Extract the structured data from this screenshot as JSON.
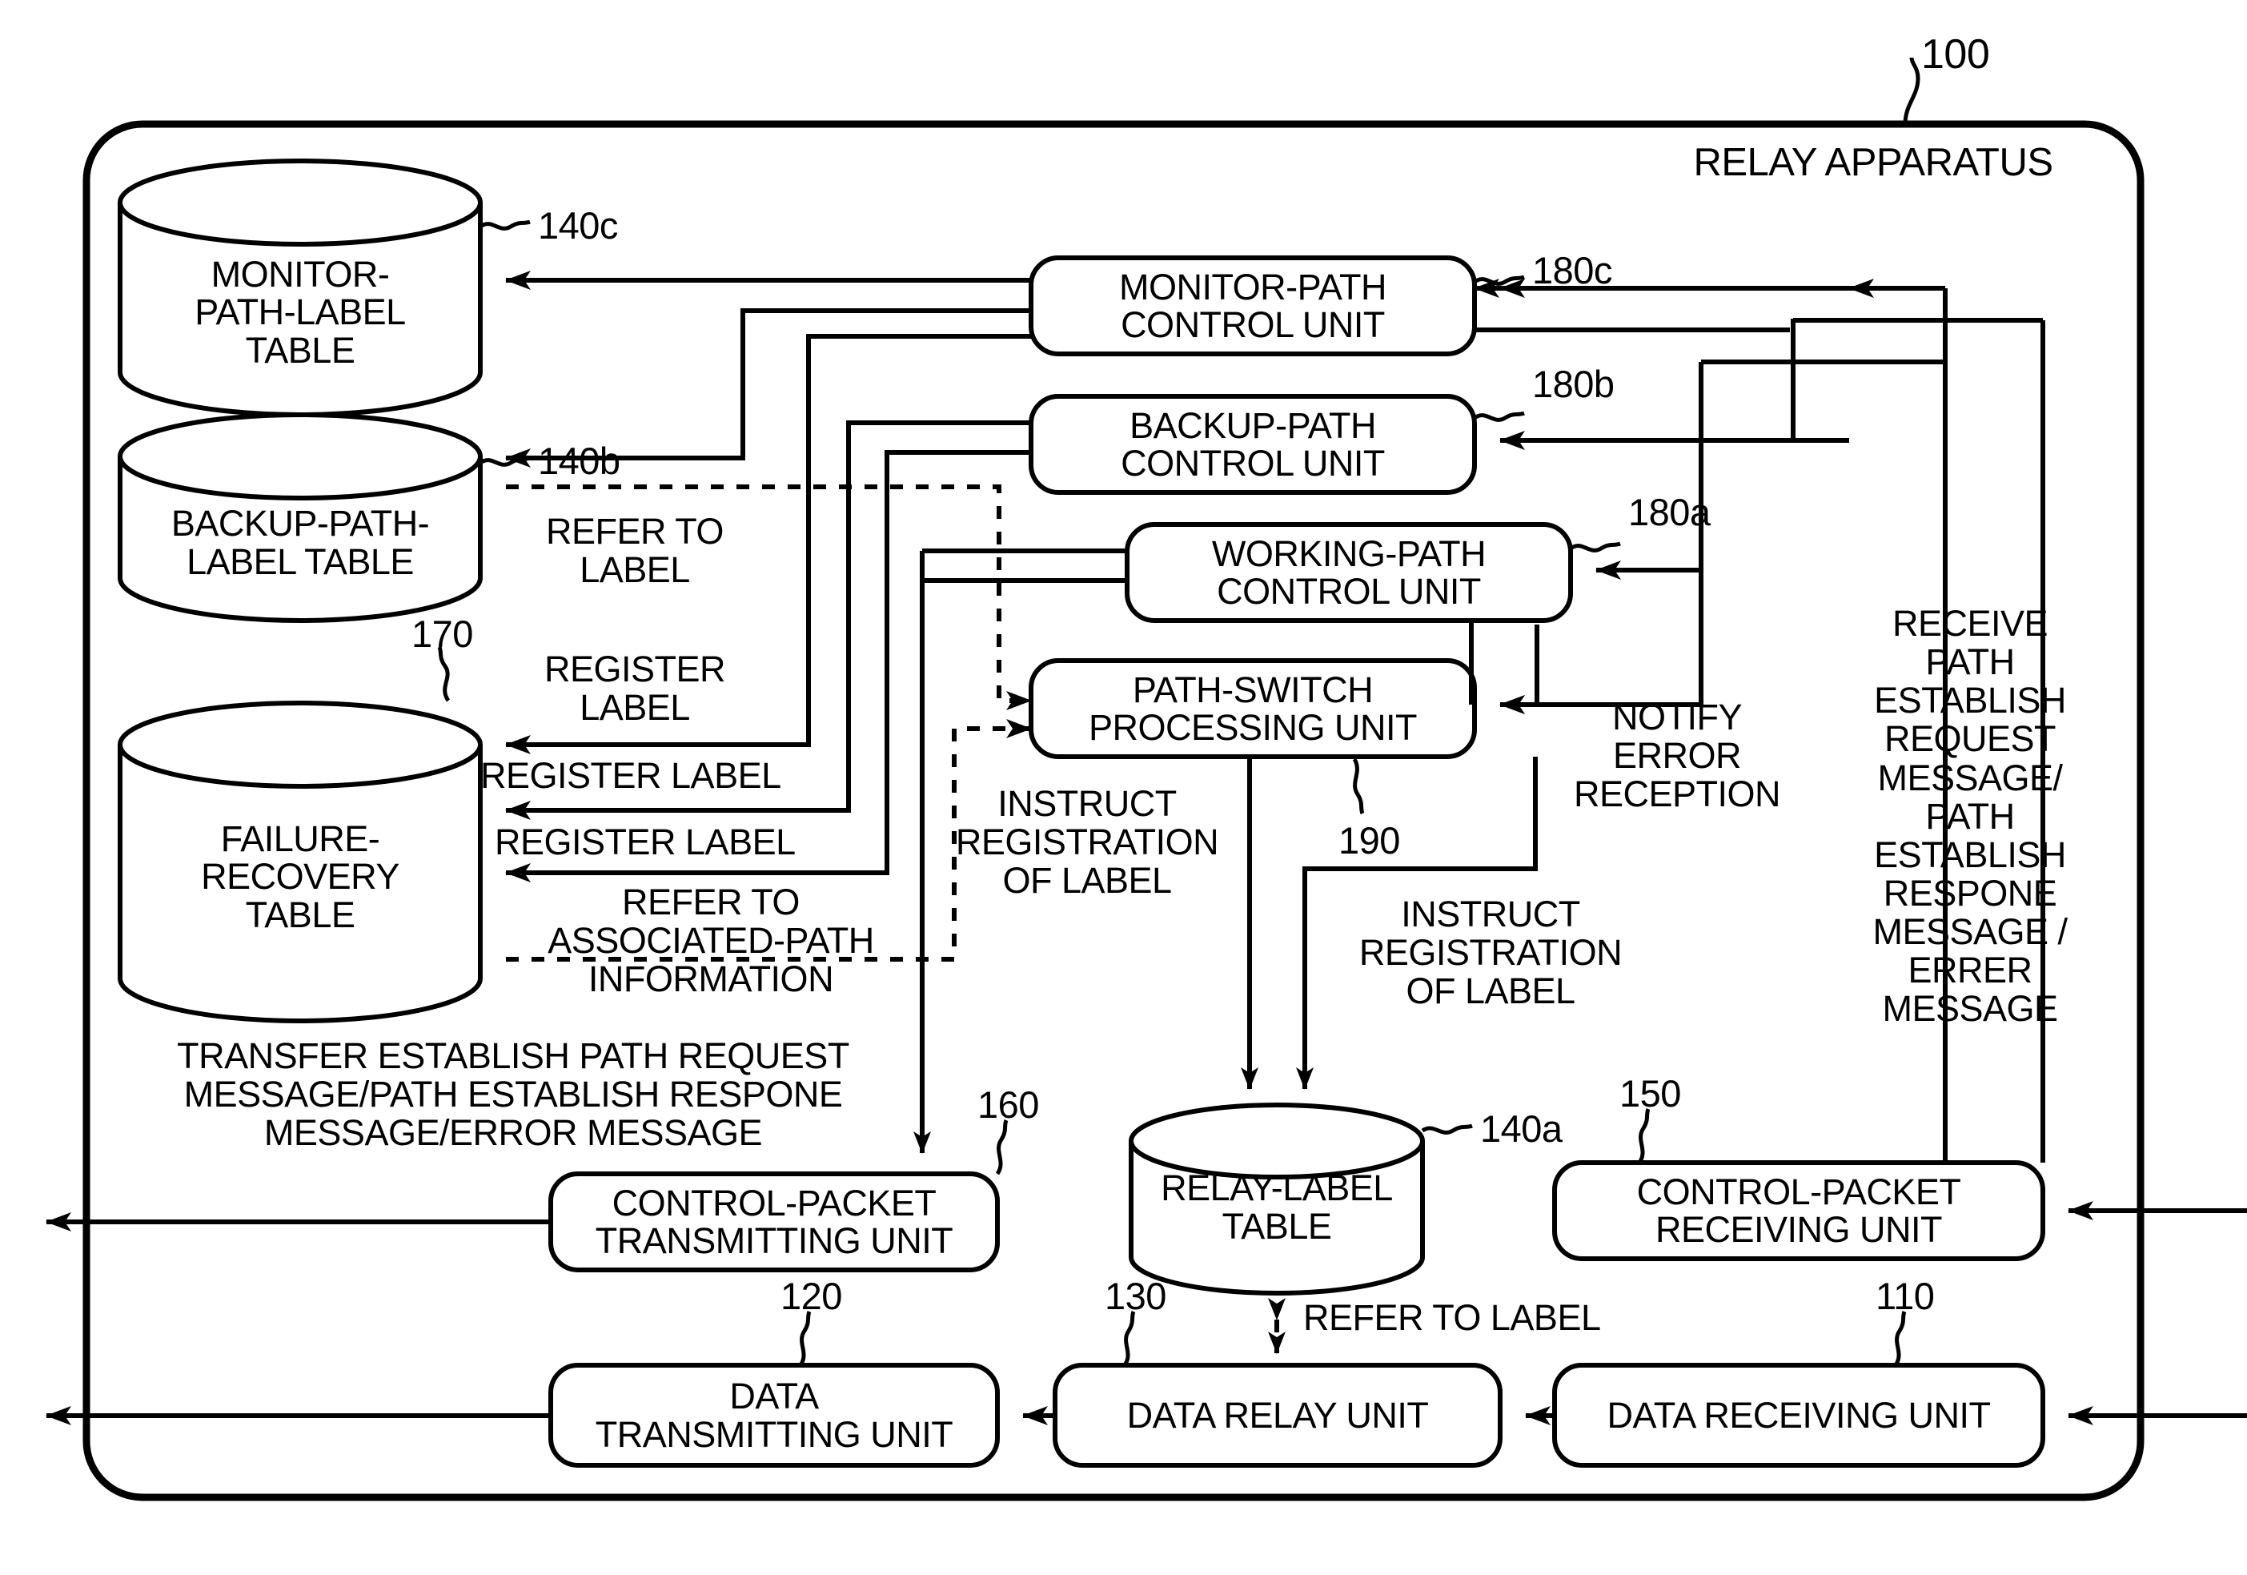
{
  "figure": {
    "title": "RELAY APPARATUS",
    "apparatus_ref": "100"
  },
  "tables": [
    {
      "id": "monitor-path-label-table",
      "label": "MONITOR-\nPATH-LABEL\nTABLE",
      "ref": "140c"
    },
    {
      "id": "backup-path-label-table",
      "label": "BACKUP-PATH-\nLABEL TABLE",
      "ref": "140b"
    },
    {
      "id": "failure-recovery-table",
      "label": "FAILURE-\nRECOVERY\nTABLE",
      "ref": "170"
    },
    {
      "id": "relay-label-table",
      "label": "RELAY-LABEL\nTABLE",
      "ref": "140a"
    }
  ],
  "units": [
    {
      "id": "monitor-path-control-unit",
      "label": "MONITOR-PATH\nCONTROL UNIT",
      "ref": "180c"
    },
    {
      "id": "backup-path-control-unit",
      "label": "BACKUP-PATH\nCONTROL UNIT",
      "ref": "180b"
    },
    {
      "id": "working-path-control-unit",
      "label": "WORKING-PATH\nCONTROL UNIT",
      "ref": "180a"
    },
    {
      "id": "path-switch-processing-unit",
      "label": "PATH-SWITCH\nPROCESSING UNIT",
      "ref": "190"
    },
    {
      "id": "control-packet-transmitting-unit",
      "label": "CONTROL-PACKET\nTRANSMITTING UNIT",
      "ref": "160"
    },
    {
      "id": "control-packet-receiving-unit",
      "label": "CONTROL-PACKET\nRECEIVING UNIT",
      "ref": "150"
    },
    {
      "id": "data-transmitting-unit",
      "label": "DATA\nTRANSMITTING UNIT",
      "ref": "120"
    },
    {
      "id": "data-relay-unit",
      "label": "DATA RELAY UNIT",
      "ref": "130"
    },
    {
      "id": "data-receiving-unit",
      "label": "DATA RECEIVING UNIT",
      "ref": "110"
    }
  ],
  "annotations": {
    "refer_to_label_1": "REFER TO\nLABEL",
    "register_label_1": "REGISTER\nLABEL",
    "register_label_2": "REGISTER LABEL",
    "register_label_3": "REGISTER LABEL",
    "refer_to_associated_path_information": "REFER TO\nASSOCIATED-PATH\nINFORMATION",
    "transfer_establish": "TRANSFER ESTABLISH PATH REQUEST\nMESSAGE/PATH ESTABLISH RESPONE\nMESSAGE/ERROR MESSAGE",
    "instruct_registration_1": "INSTRUCT\nREGISTRATION\nOF LABEL",
    "instruct_registration_2": "INSTRUCT\nREGISTRATION\nOF LABEL",
    "notify_error_reception": "NOTIFY\nERROR\nRECEPTION",
    "receive_path_establish": "RECEIVE\nPATH\nESTABLISH\nREQUEST\nMESSAGE/\nPATH\nESTABLISH\nRESPONE\nMESSAGE /\nERRER\nMESSAGE",
    "refer_to_label_2": "REFER TO LABEL"
  },
  "colors": {
    "line": "#000000",
    "background": "#ffffff"
  }
}
